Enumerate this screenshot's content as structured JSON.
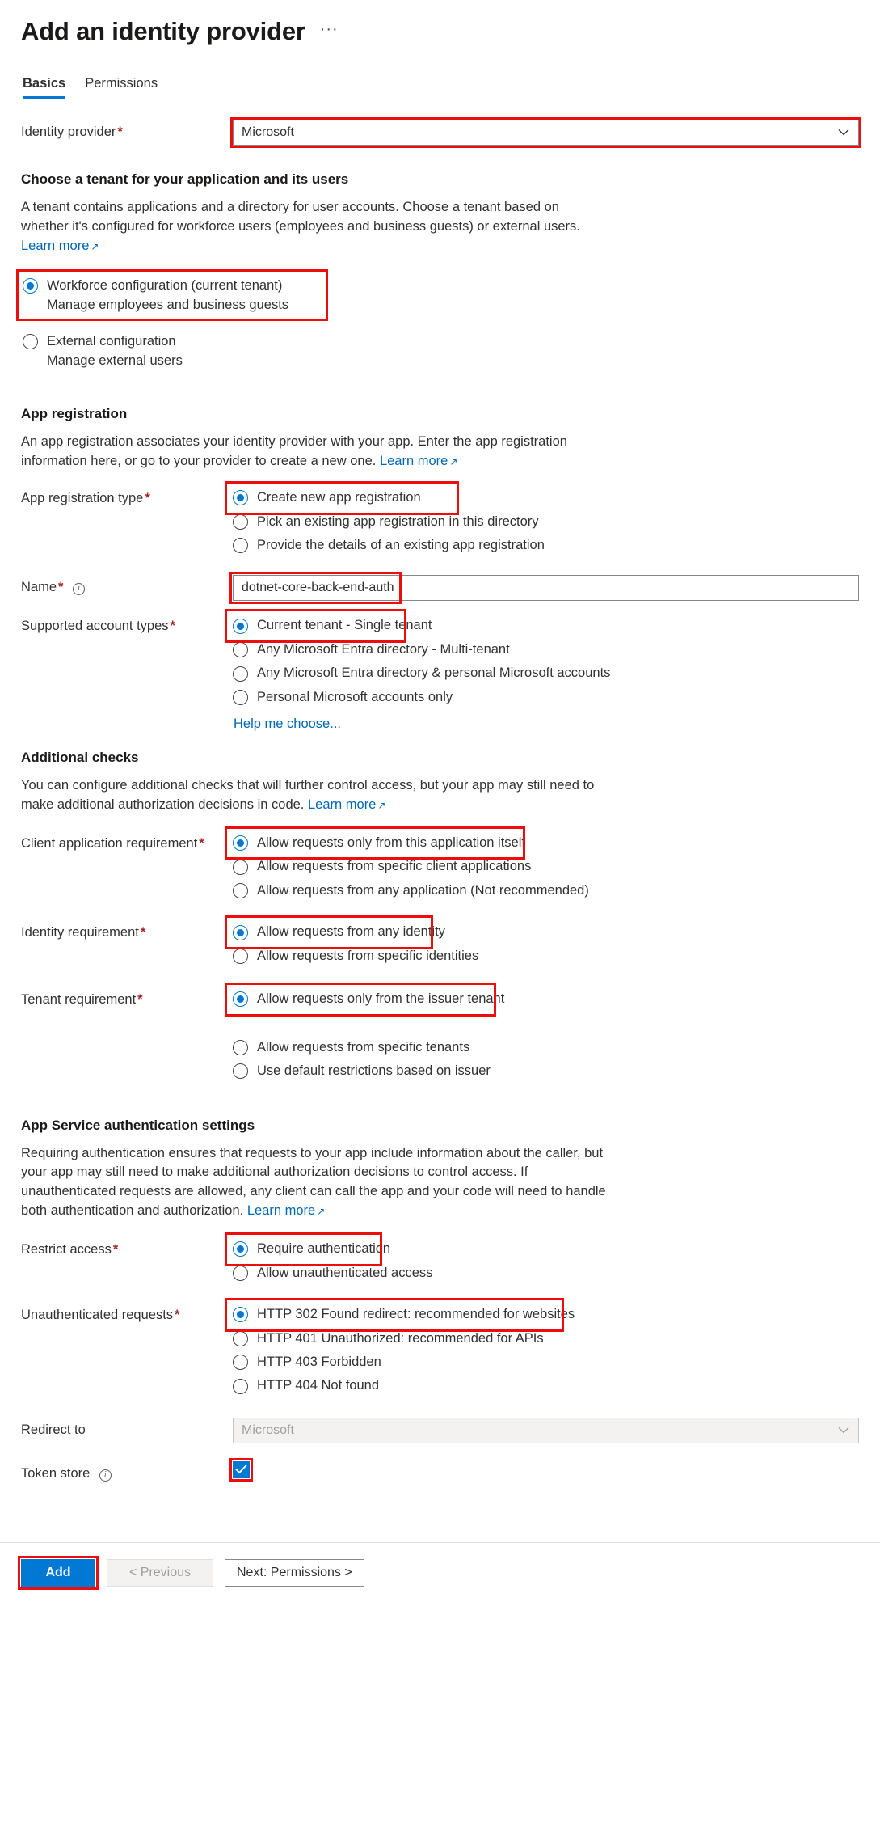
{
  "header": {
    "title": "Add an identity provider",
    "more_label": "···"
  },
  "tabs": [
    {
      "label": "Basics",
      "active": true
    },
    {
      "label": "Permissions",
      "active": false
    }
  ],
  "identity_provider": {
    "label": "Identity provider",
    "required": "*",
    "value": "Microsoft",
    "chevron": "⌄"
  },
  "tenant_section": {
    "heading": "Choose a tenant for your application and its users",
    "description": "A tenant contains applications and a directory for user accounts. Choose a tenant based on whether it's configured for workforce users (employees and business guests) or external users.",
    "learn_more": "Learn more",
    "ext_icon": "↗",
    "options": [
      {
        "label": "Workforce configuration (current tenant)",
        "sub": "Manage employees and business guests",
        "checked": true
      },
      {
        "label": "External configuration",
        "sub": "Manage external users",
        "checked": false
      }
    ]
  },
  "app_registration": {
    "heading": "App registration",
    "description": "An app registration associates your identity provider with your app. Enter the app registration information here, or go to your provider to create a new one.",
    "learn_more": "Learn more",
    "type_label": "App registration type",
    "required": "*",
    "type_options": [
      {
        "label": "Create new app registration",
        "checked": true
      },
      {
        "label": "Pick an existing app registration in this directory",
        "checked": false
      },
      {
        "label": "Provide the details of an existing app registration",
        "checked": false
      }
    ],
    "name_label": "Name",
    "name_value": "dotnet-core-back-end-auth",
    "account_types_label": "Supported account types",
    "account_type_options": [
      {
        "label": "Current tenant - Single tenant",
        "checked": true
      },
      {
        "label": "Any Microsoft Entra directory - Multi-tenant",
        "checked": false
      },
      {
        "label": "Any Microsoft Entra directory & personal Microsoft accounts",
        "checked": false
      },
      {
        "label": "Personal Microsoft accounts only",
        "checked": false
      }
    ],
    "help_me_choose": "Help me choose..."
  },
  "additional_checks": {
    "heading": "Additional checks",
    "description": "You can configure additional checks that will further control access, but your app may still need to make additional authorization decisions in code.",
    "learn_more": "Learn more",
    "client_label": "Client application requirement",
    "required": "*",
    "client_options": [
      {
        "label": "Allow requests only from this application itself",
        "checked": true
      },
      {
        "label": "Allow requests from specific client applications",
        "checked": false
      },
      {
        "label": "Allow requests from any application (Not recommended)",
        "checked": false
      }
    ],
    "identity_label": "Identity requirement",
    "identity_options": [
      {
        "label": "Allow requests from any identity",
        "checked": true
      },
      {
        "label": "Allow requests from specific identities",
        "checked": false
      }
    ],
    "tenant_label": "Tenant requirement",
    "tenant_options": [
      {
        "label": "Allow requests only from the issuer tenant",
        "checked": true
      },
      {
        "label": "Allow requests from specific tenants",
        "checked": false
      },
      {
        "label": "Use default restrictions based on issuer",
        "checked": false
      }
    ]
  },
  "app_service_auth": {
    "heading": "App Service authentication settings",
    "description": "Requiring authentication ensures that requests to your app include information about the caller, but your app may still need to make additional authorization decisions to control access. If unauthenticated requests are allowed, any client can call the app and your code will need to handle both authentication and authorization.",
    "learn_more": "Learn more",
    "restrict_label": "Restrict access",
    "required": "*",
    "restrict_options": [
      {
        "label": "Require authentication",
        "checked": true
      },
      {
        "label": "Allow unauthenticated access",
        "checked": false
      }
    ],
    "unauth_label": "Unauthenticated requests",
    "unauth_options": [
      {
        "label": "HTTP 302 Found redirect: recommended for websites",
        "checked": true
      },
      {
        "label": "HTTP 401 Unauthorized: recommended for APIs",
        "checked": false
      },
      {
        "label": "HTTP 403 Forbidden",
        "checked": false
      },
      {
        "label": "HTTP 404 Not found",
        "checked": false
      }
    ],
    "redirect_label": "Redirect to",
    "redirect_value": "Microsoft",
    "token_store_label": "Token store",
    "token_store_checked": true
  },
  "footer": {
    "add_label": "Add",
    "previous_label": "< Previous",
    "next_label": "Next: Permissions >"
  },
  "colors": {
    "accent": "#0078d4",
    "link": "#0067b8",
    "required": "#a4262c",
    "highlight": "#ef0c0c"
  }
}
